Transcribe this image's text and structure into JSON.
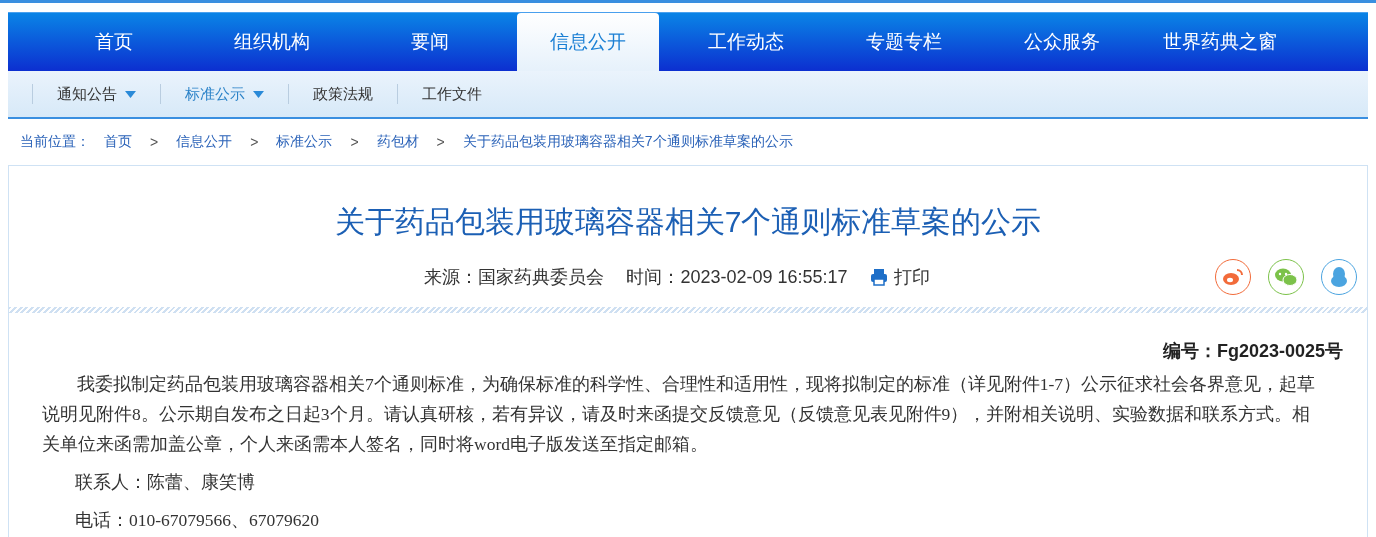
{
  "main_nav": [
    {
      "label": "首页",
      "selected": false
    },
    {
      "label": "组织机构",
      "selected": false
    },
    {
      "label": "要闻",
      "selected": false
    },
    {
      "label": "信息公开",
      "selected": true
    },
    {
      "label": "工作动态",
      "selected": false
    },
    {
      "label": "专题专栏",
      "selected": false
    },
    {
      "label": "公众服务",
      "selected": false
    },
    {
      "label": "世界药典之窗",
      "selected": false
    }
  ],
  "sub_nav": [
    {
      "label": "通知公告",
      "selected": false,
      "dropdown": true
    },
    {
      "label": "标准公示",
      "selected": true,
      "dropdown": true
    },
    {
      "label": "政策法规",
      "selected": false,
      "dropdown": false
    },
    {
      "label": "工作文件",
      "selected": false,
      "dropdown": false
    }
  ],
  "breadcrumb": {
    "label": "当前位置：",
    "items": [
      "首页",
      "信息公开",
      "标准公示",
      "药包材",
      "关于药品包装用玻璃容器相关7个通则标准草案的公示"
    ],
    "separator": ">"
  },
  "article": {
    "title": "关于药品包装用玻璃容器相关7个通则标准草案的公示",
    "source": "来源：国家药典委员会",
    "time": "时间：2023-02-09 16:55:17",
    "print": "打印",
    "share": [
      {
        "kind": "weibo",
        "color": "#f26b3a"
      },
      {
        "kind": "wechat",
        "color": "#7cc24a"
      },
      {
        "kind": "qq",
        "color": "#4ba4e0"
      }
    ],
    "doc_number": "编号：Fg2023-0025号",
    "paragraphs": [
      "我委拟制定药品包装用玻璃容器相关7个通则标准，为确保标准的科学性、合理性和适用性，现将拟制定的标准（详见附件1-7）公示征求社会各界意见，起草说明见附件8。公示期自发布之日起3个月。请认真研核，若有异议，请及时来函提交反馈意见（反馈意见表见附件9），并附相关说明、实验数据和联系方式。相关单位来函需加盖公章，个人来函需本人签名，同时将word电子版发送至指定邮箱。",
      "联系人：陈蕾、康笑博",
      "电话：010-67079566、67079620"
    ]
  }
}
